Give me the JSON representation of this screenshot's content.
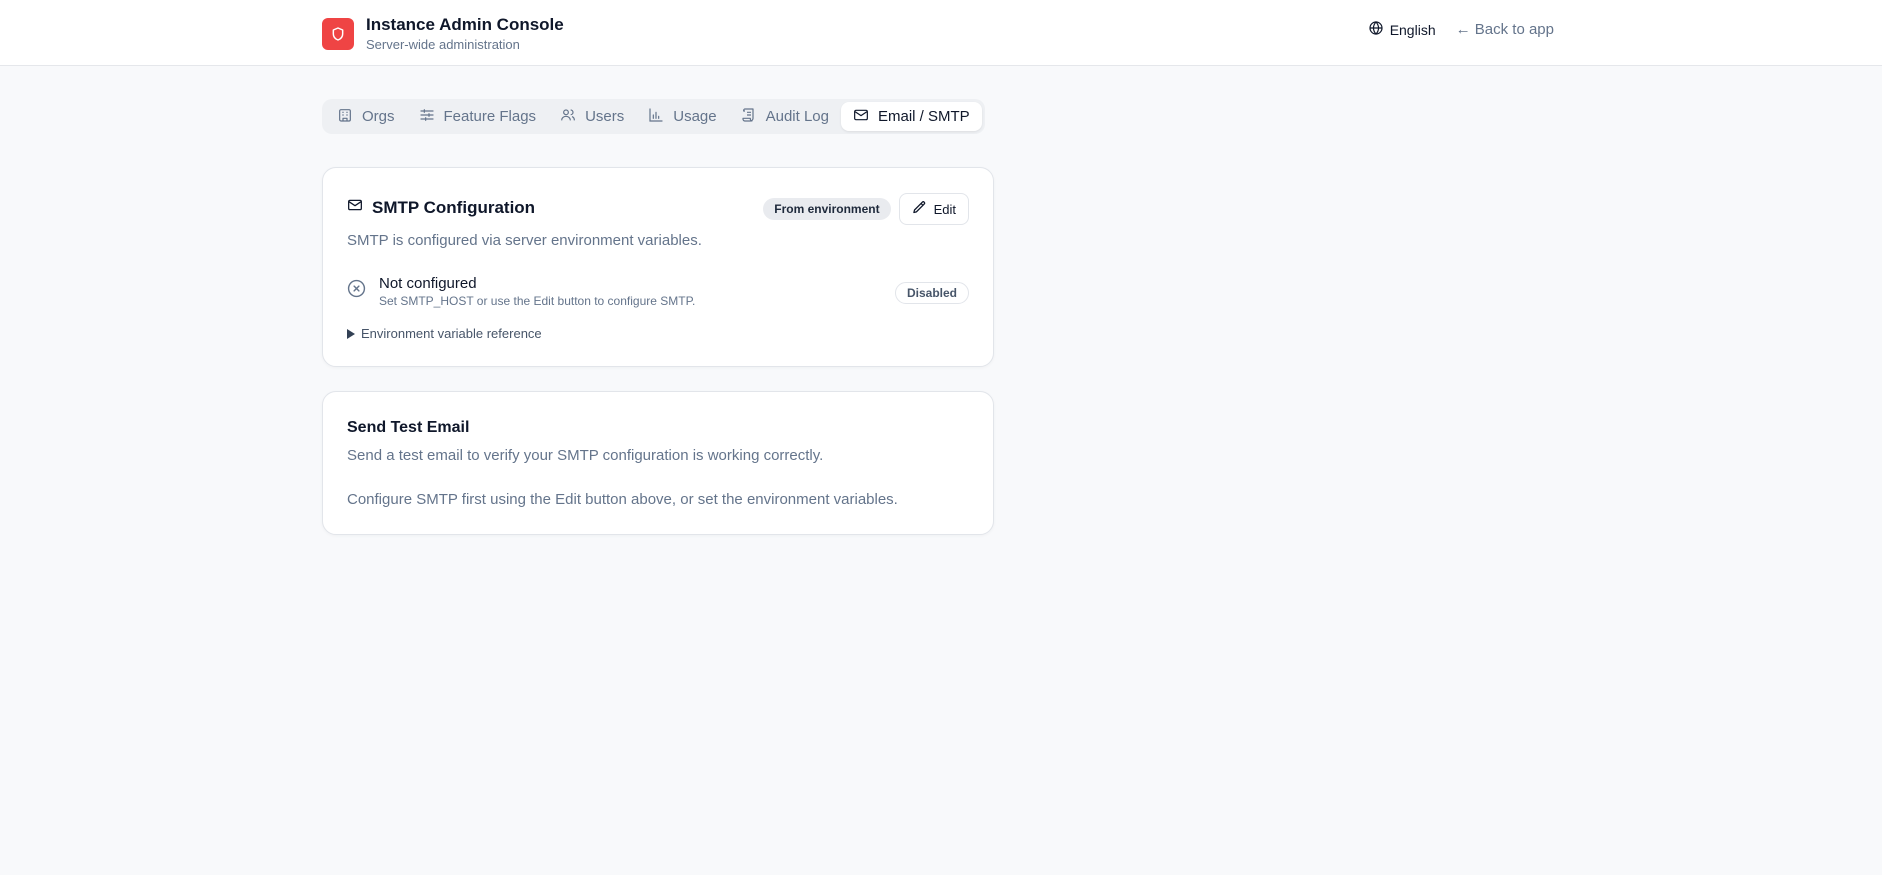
{
  "header": {
    "title": "Instance Admin Console",
    "subtitle": "Server-wide administration",
    "language": "English",
    "back_link": "← Back to app"
  },
  "tabs": [
    {
      "label": "Orgs",
      "icon": "building-icon",
      "active": false
    },
    {
      "label": "Feature Flags",
      "icon": "sliders-icon",
      "active": false
    },
    {
      "label": "Users",
      "icon": "users-icon",
      "active": false
    },
    {
      "label": "Usage",
      "icon": "bar-chart-icon",
      "active": false
    },
    {
      "label": "Audit Log",
      "icon": "scroll-icon",
      "active": false
    },
    {
      "label": "Email / SMTP",
      "icon": "mail-icon",
      "active": true
    }
  ],
  "smtp_card": {
    "title": "SMTP Configuration",
    "source_badge": "From environment",
    "edit_label": "Edit",
    "description": "SMTP is configured via server environment variables.",
    "status_title": "Not configured",
    "status_detail": "Set SMTP_HOST or use the Edit button to configure SMTP.",
    "status_badge": "Disabled",
    "env_reference_label": "Environment variable reference"
  },
  "test_card": {
    "title": "Send Test Email",
    "description": "Send a test email to verify your SMTP configuration is working correctly.",
    "note": "Configure SMTP first using the Edit button above, or set the environment variables."
  },
  "colors": {
    "brand": "#ef4444",
    "background": "#f8f9fb",
    "muted_text": "#64748b"
  }
}
